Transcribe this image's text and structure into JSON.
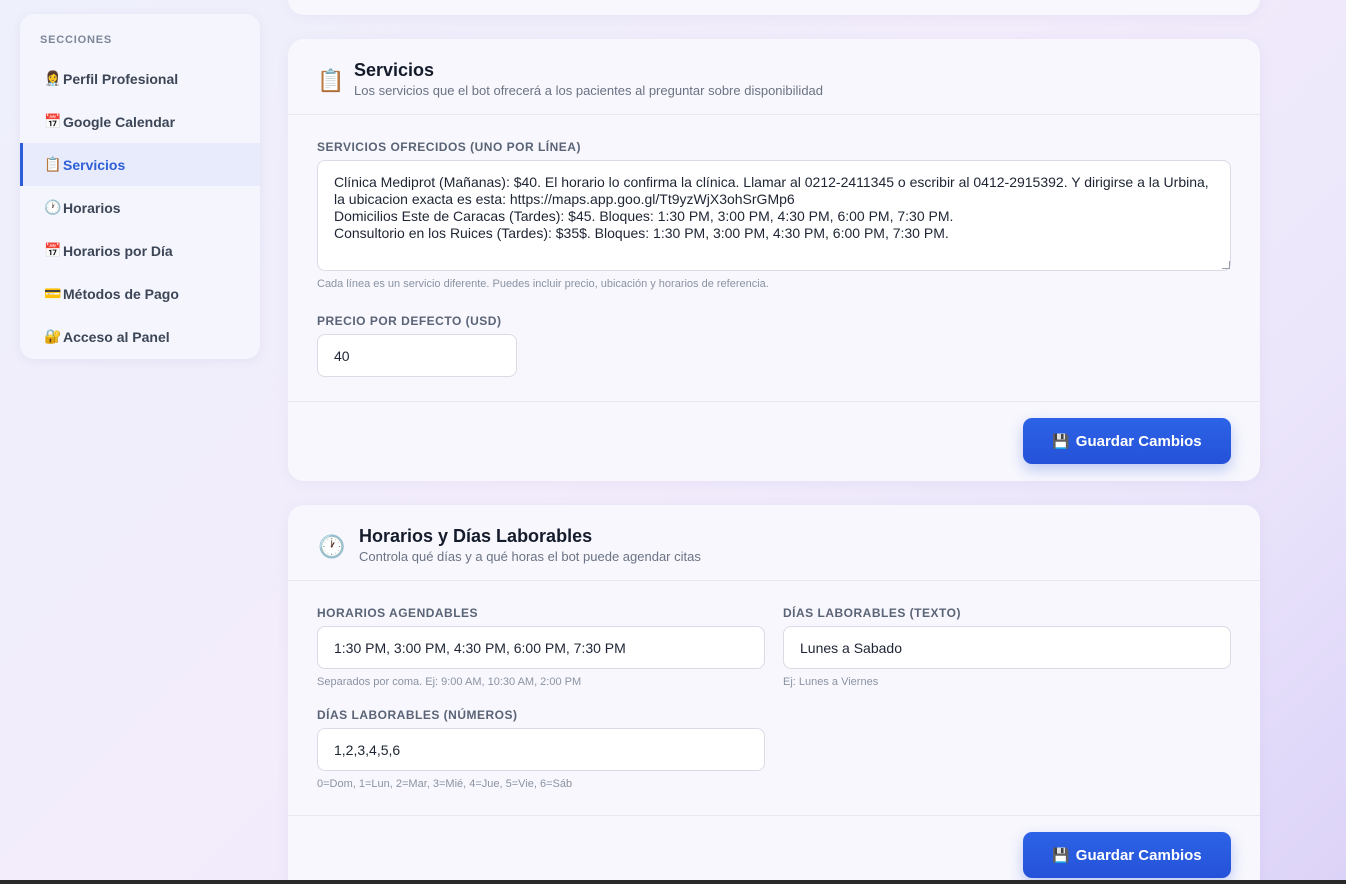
{
  "sidebar": {
    "title": "SECCIONES",
    "items": [
      {
        "icon": "👩‍⚕️",
        "label": "Perfil Profesional"
      },
      {
        "icon": "📅",
        "label": "Google Calendar"
      },
      {
        "icon": "📋",
        "label": "Servicios"
      },
      {
        "icon": "🕐",
        "label": "Horarios"
      },
      {
        "icon": "📅",
        "label": "Horarios por Día"
      },
      {
        "icon": "💳",
        "label": "Métodos de Pago"
      },
      {
        "icon": "🔐",
        "label": "Acceso al Panel"
      }
    ],
    "active_index": 2
  },
  "servicios": {
    "icon": "📋",
    "title": "Servicios",
    "subtitle": "Los servicios que el bot ofrecerá a los pacientes al preguntar sobre disponibilidad",
    "services_label": "SERVICIOS OFRECIDOS (UNO POR LÍNEA)",
    "services_value": "Clínica Mediprot (Mañanas): $40. El horario lo confirma la clínica. Llamar al 0212-2411345 o escribir al 0412-2915392. Y dirigirse a la Urbina, la ubicacion exacta es esta: https://maps.app.goo.gl/Tt9yzWjX3ohSrGMp6\nDomicilios Este de Caracas (Tardes): $45. Bloques: 1:30 PM, 3:00 PM, 4:30 PM, 6:00 PM, 7:30 PM.\nConsultorio en los Ruices (Tardes): $35$. Bloques: 1:30 PM, 3:00 PM, 4:30 PM, 6:00 PM, 7:30 PM.",
    "services_hint": "Cada línea es un servicio diferente. Puedes incluir precio, ubicación y horarios de referencia.",
    "price_label": "PRECIO POR DEFECTO (USD)",
    "price_value": "40",
    "save_icon": "💾",
    "save_label": "Guardar Cambios"
  },
  "horarios": {
    "icon": "🕐",
    "title": "Horarios y Días Laborables",
    "subtitle": "Controla qué días y a qué horas el bot puede agendar citas",
    "slots_label": "HORARIOS AGENDABLES",
    "slots_value": "1:30 PM, 3:00 PM, 4:30 PM, 6:00 PM, 7:30 PM",
    "slots_hint": "Separados por coma. Ej: 9:00 AM, 10:30 AM, 2:00 PM",
    "days_text_label": "DÍAS LABORABLES (TEXTO)",
    "days_text_value": "Lunes a Sabado",
    "days_text_hint": "Ej: Lunes a Viernes",
    "days_num_label": "DÍAS LABORABLES (NÚMEROS)",
    "days_num_value": "1,2,3,4,5,6",
    "days_num_hint": "0=Dom, 1=Lun, 2=Mar, 3=Mié, 4=Jue, 5=Vie, 6=Sáb",
    "save_icon": "💾",
    "save_label": "Guardar Cambios"
  }
}
